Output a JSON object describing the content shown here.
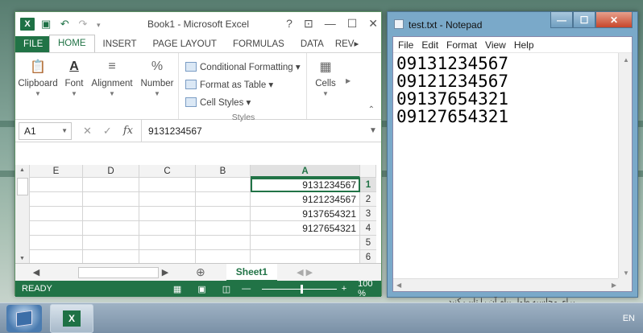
{
  "excel": {
    "window_title": "Book1 - Microsoft Excel",
    "title_controls": [
      "?",
      "⊡",
      "—",
      "☐",
      "✕"
    ],
    "tabs": [
      "FILE",
      "HOME",
      "INSERT",
      "PAGE LAYOUT",
      "FORMULAS",
      "DATA",
      "REV▸"
    ],
    "ribbon": {
      "clipboard": "Clipboard",
      "font": "Font",
      "alignment": "Alignment",
      "number": "Number",
      "conditional_formatting": "Conditional Formatting ▾",
      "format_as_table": "Format as Table ▾",
      "cell_styles": "Cell Styles ▾",
      "styles_caption": "Styles",
      "cells": "Cells"
    },
    "name_box": "A1",
    "formula_value": "9131234567",
    "columns": [
      "E",
      "D",
      "C",
      "B",
      "A"
    ],
    "rows": [
      {
        "num": "1",
        "a": "9131234567"
      },
      {
        "num": "2",
        "a": "9121234567"
      },
      {
        "num": "3",
        "a": "9137654321"
      },
      {
        "num": "4",
        "a": "9127654321"
      },
      {
        "num": "5",
        "a": ""
      },
      {
        "num": "6",
        "a": ""
      }
    ],
    "sheet_tab": "Sheet1",
    "status": "READY",
    "zoom": "100 %"
  },
  "notepad": {
    "window_title": "test.txt - Notepad",
    "menu": [
      "File",
      "Edit",
      "Format",
      "View",
      "Help"
    ],
    "lines": [
      "09131234567",
      "09121234567",
      "09137654321",
      "09127654321"
    ]
  },
  "taskbar": {
    "lang": "EN"
  },
  "footnote": "برای محاسبه طول پیام آن را تایپ کنید"
}
